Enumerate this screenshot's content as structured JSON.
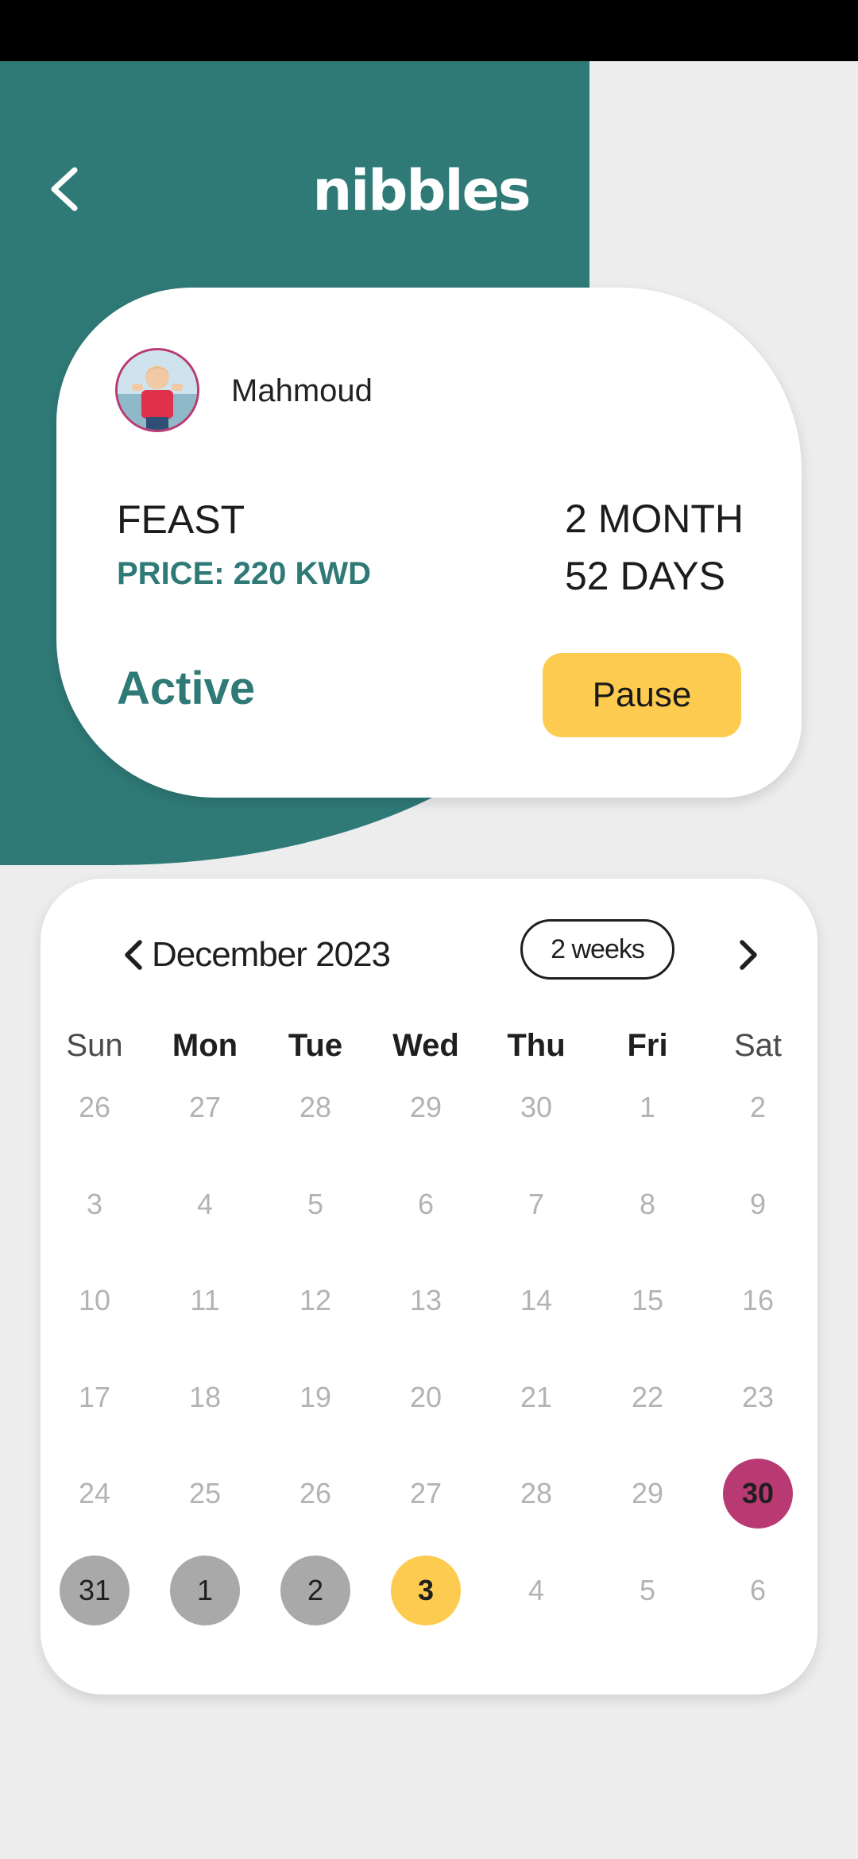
{
  "brand": {
    "name": "nibbles"
  },
  "header": {
    "back_icon": "chevron-left-icon"
  },
  "subscription": {
    "child_name": "Mahmoud",
    "plan": "FEAST",
    "price": "PRICE: 220 KWD",
    "duration": "2 MONTH",
    "days": "52 DAYS",
    "status": "Active",
    "pause_label": "Pause"
  },
  "calendar": {
    "month_label": "December 2023",
    "range_label": "2 weeks",
    "prev_icon": "chevron-left-icon",
    "next_icon": "chevron-right-icon",
    "weekdays": [
      "Sun",
      "Mon",
      "Tue",
      "Wed",
      "Thu",
      "Fri",
      "Sat"
    ],
    "weeks": [
      [
        "26",
        "27",
        "28",
        "29",
        "30",
        "1",
        "2"
      ],
      [
        "3",
        "4",
        "5",
        "6",
        "7",
        "8",
        "9"
      ],
      [
        "10",
        "11",
        "12",
        "13",
        "14",
        "15",
        "16"
      ],
      [
        "17",
        "18",
        "19",
        "20",
        "21",
        "22",
        "23"
      ],
      [
        "24",
        "25",
        "26",
        "27",
        "28",
        "29",
        "30"
      ],
      [
        "31",
        "1",
        "2",
        "3",
        "4",
        "5",
        "6"
      ]
    ],
    "highlighted_days": [
      {
        "week": 4,
        "day": 6,
        "state": "start"
      },
      {
        "week": 5,
        "day": 0,
        "state": "delivered"
      },
      {
        "week": 5,
        "day": 1,
        "state": "delivered"
      },
      {
        "week": 5,
        "day": 2,
        "state": "delivered"
      },
      {
        "week": 5,
        "day": 3,
        "state": "today"
      }
    ]
  },
  "colors": {
    "brand_teal": "#2f7a77",
    "accent_yellow": "#fdcb4f",
    "start_magenta": "#b93a73",
    "delivered_gray": "#a9a9a9"
  }
}
